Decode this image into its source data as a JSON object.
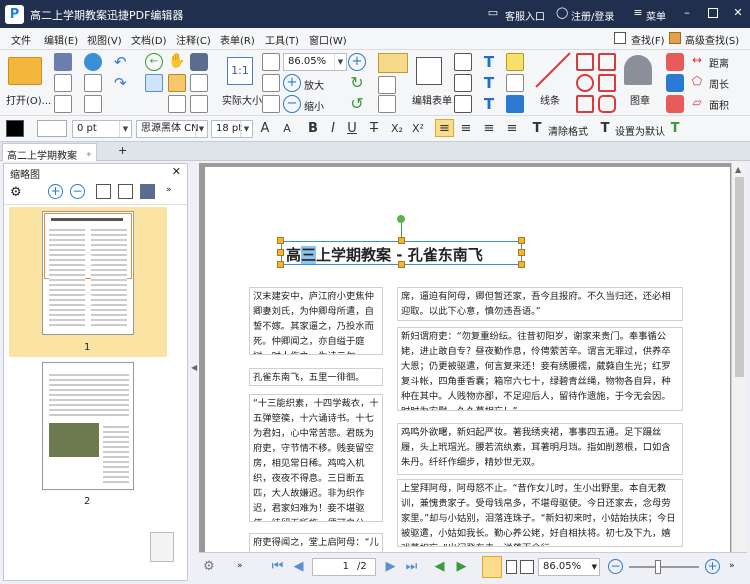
{
  "window": {
    "title": "高二上学期教案迅捷PDF编辑器",
    "service": "客服入口",
    "login": "注册/登录",
    "menu": "菜单",
    "logo_letter": "P"
  },
  "menubar": {
    "items": [
      "文件",
      "编辑(E)",
      "视图(V)",
      "文档(D)",
      "注释(C)",
      "表单(R)",
      "工具(T)",
      "窗口(W)"
    ],
    "find": "查找(F)",
    "advanced_find": "高级查找(S)"
  },
  "toolbar": {
    "open": "打开(O)...",
    "actual_size": "实际大小",
    "zoom_value": "86.05%",
    "zoom_in": "放大",
    "zoom_out": "缩小",
    "edit_form": "编辑表单",
    "lines": "线条",
    "stamp": "图章",
    "distance": "距离",
    "perimeter": "周长",
    "area": "面积"
  },
  "formatbar": {
    "line_width": "0 pt",
    "font_name": "思源黑体 CN",
    "font_size": "18 pt",
    "clear_format": "清除格式",
    "set_default": "设置为默认"
  },
  "tab": {
    "name": "高二上学期教案"
  },
  "panel": {
    "title": "缩略图",
    "pages": [
      "1",
      "2"
    ]
  },
  "document": {
    "title_pre": "高",
    "title_sel": "三",
    "title_post": "上学期教案 - 孔雀东南飞",
    "left_blocks": [
      "汉末建安中，庐江府小吏焦仲卿妻刘氏，为仲卿母所遣，自誓不嫁。其家逼之，乃投水而死。仲卿闻之，亦自缢于庭树。时人伤之，为诗云尔。",
      "孔雀东南飞，五里一徘徊。",
      "“十三能织素，十四学裁衣，十五弹箜篌，十六诵诗书。十七为君妇，心中常苦悲。君既为府吏，守节情不移。贱妾留空房，相见常日稀。鸡鸣入机织，夜夜不得息。三日断五匹，大人故嫌迟。非为织作迟，君家妇难为！妾不堪驱使，徒留无所施。便可白公姥，及时相遣归。”",
      "府吏得闻之，堂上启阿母：“儿已薄禄相，幸复得此妇，结发同枕席"
    ],
    "right_blocks": [
      "席，逼迫有阿母，卿但暂还家，吾今且报府。不久当归还，还必相迎取。以此下心意，慎勿违吾语。”",
      "新妇谓府吏：“勿复重纷纭。往昔初阳岁，谢家来贵门。奉事循公姥，进止敢自专？昼夜勤作息，伶俜萦苦辛。谓言无罪过，供养卒大恩；仍更被驱遣，何言复来还！妾有绣腰襦，葳蕤自生光；红罗复斗帐，四角垂香囊；箱帘六七十，绿碧青丝绳，物物各自异，种种在其中。人贱物亦鄙，不足迎后人，留待作遗施，于今无会因。时时为安慰，久久莫相忘！”",
      "鸡鸣外欲曙，新妇起严妆。著我绣夹裙，事事四五通。足下蹑丝履，头上玳瑁光。腰若流纨素，耳著明月珰。指如削葱根，口如含朱丹。纤纤作细步，精妙世无双。",
      "上堂拜阿母，阿母怒不止。“昔作女儿时，生小出野里。本自无教训，兼愧贵家子。受母钱帛多，不堪母驱使。今日还家去，念母劳家里。”却与小姑别，泪落连珠子。“新妇初来时，小姑始扶床；今日被驱遣，小姑如我长。勤心养公姥，好自相扶将。初七及下九，嬉戏莫相忘。”出门登车去，涕落百余行。"
    ]
  },
  "status": {
    "page_input": "1",
    "page_total": "/2",
    "zoom": "86.05%"
  },
  "colors": {
    "titlebar": "#1f2f4d",
    "accent": "#1e84d8",
    "handle": "#f2b630",
    "selection": "#8fc3ef",
    "thumb_selected": "#fbe3a4"
  }
}
